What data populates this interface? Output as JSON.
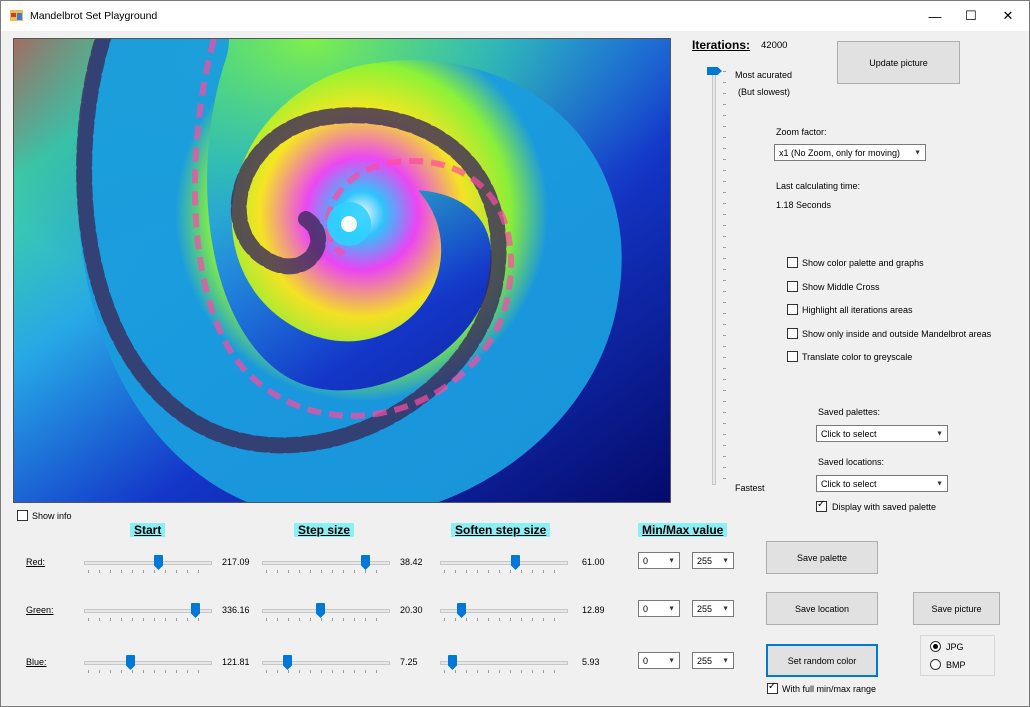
{
  "window": {
    "title": "Mandelbrot Set Playground",
    "minimize": "—",
    "maximize": "☐",
    "close": "✕"
  },
  "show_info": {
    "label": "Show info",
    "checked": false
  },
  "iterations": {
    "label": "Iterations:",
    "value": "42000",
    "top_label": "Most acurated",
    "top_sub": "(But slowest)",
    "bottom_label": "Fastest"
  },
  "buttons": {
    "update_picture": "Update picture",
    "save_palette": "Save  palette",
    "save_location": "Save location",
    "save_picture": "Save picture",
    "set_random_color": "Set random color"
  },
  "zoom": {
    "label": "Zoom factor:",
    "selected": "x1 (No Zoom, only for moving)"
  },
  "calc_time": {
    "label": "Last calculating time:",
    "value": "1.18 Seconds"
  },
  "options": [
    {
      "label": "Show color palette and graphs",
      "checked": false
    },
    {
      "label": "Show Middle Cross",
      "checked": false
    },
    {
      "label": "Highlight all iterations areas",
      "checked": false
    },
    {
      "label": "Show only inside and outside Mandelbrot areas",
      "checked": false
    },
    {
      "label": "Translate color to greyscale",
      "checked": false
    }
  ],
  "saved_palettes": {
    "label": "Saved palettes:",
    "selected": "Click to select"
  },
  "saved_locations": {
    "label": "Saved locations:",
    "selected": "Click to select"
  },
  "display_saved_palette": {
    "label": "Display with saved palette",
    "checked": true
  },
  "headings": {
    "start": "Start",
    "step": "Step size",
    "soften": "Soften step size",
    "minmax": "Min/Max value"
  },
  "channels": [
    {
      "name": "Red:",
      "start": "217.09",
      "step": "38.42",
      "soften": "61.00",
      "min": "0",
      "max": "255",
      "start_frac": 0.59,
      "step_frac": 0.83,
      "soften_frac": 0.6
    },
    {
      "name": "Green:",
      "start": "336.16",
      "step": "20.30",
      "soften": "12.89",
      "min": "0",
      "max": "255",
      "start_frac": 0.9,
      "step_frac": 0.45,
      "soften_frac": 0.14
    },
    {
      "name": "Blue:",
      "start": "121.81",
      "step": "7.25",
      "soften": "5.93",
      "min": "0",
      "max": "255",
      "start_frac": 0.35,
      "step_frac": 0.18,
      "soften_frac": 0.07
    }
  ],
  "format": {
    "options": [
      "JPG",
      "BMP"
    ],
    "selected": "JPG"
  },
  "full_range": {
    "label": "With full min/max range",
    "checked": true
  },
  "iterations_slider_frac": 1.0
}
